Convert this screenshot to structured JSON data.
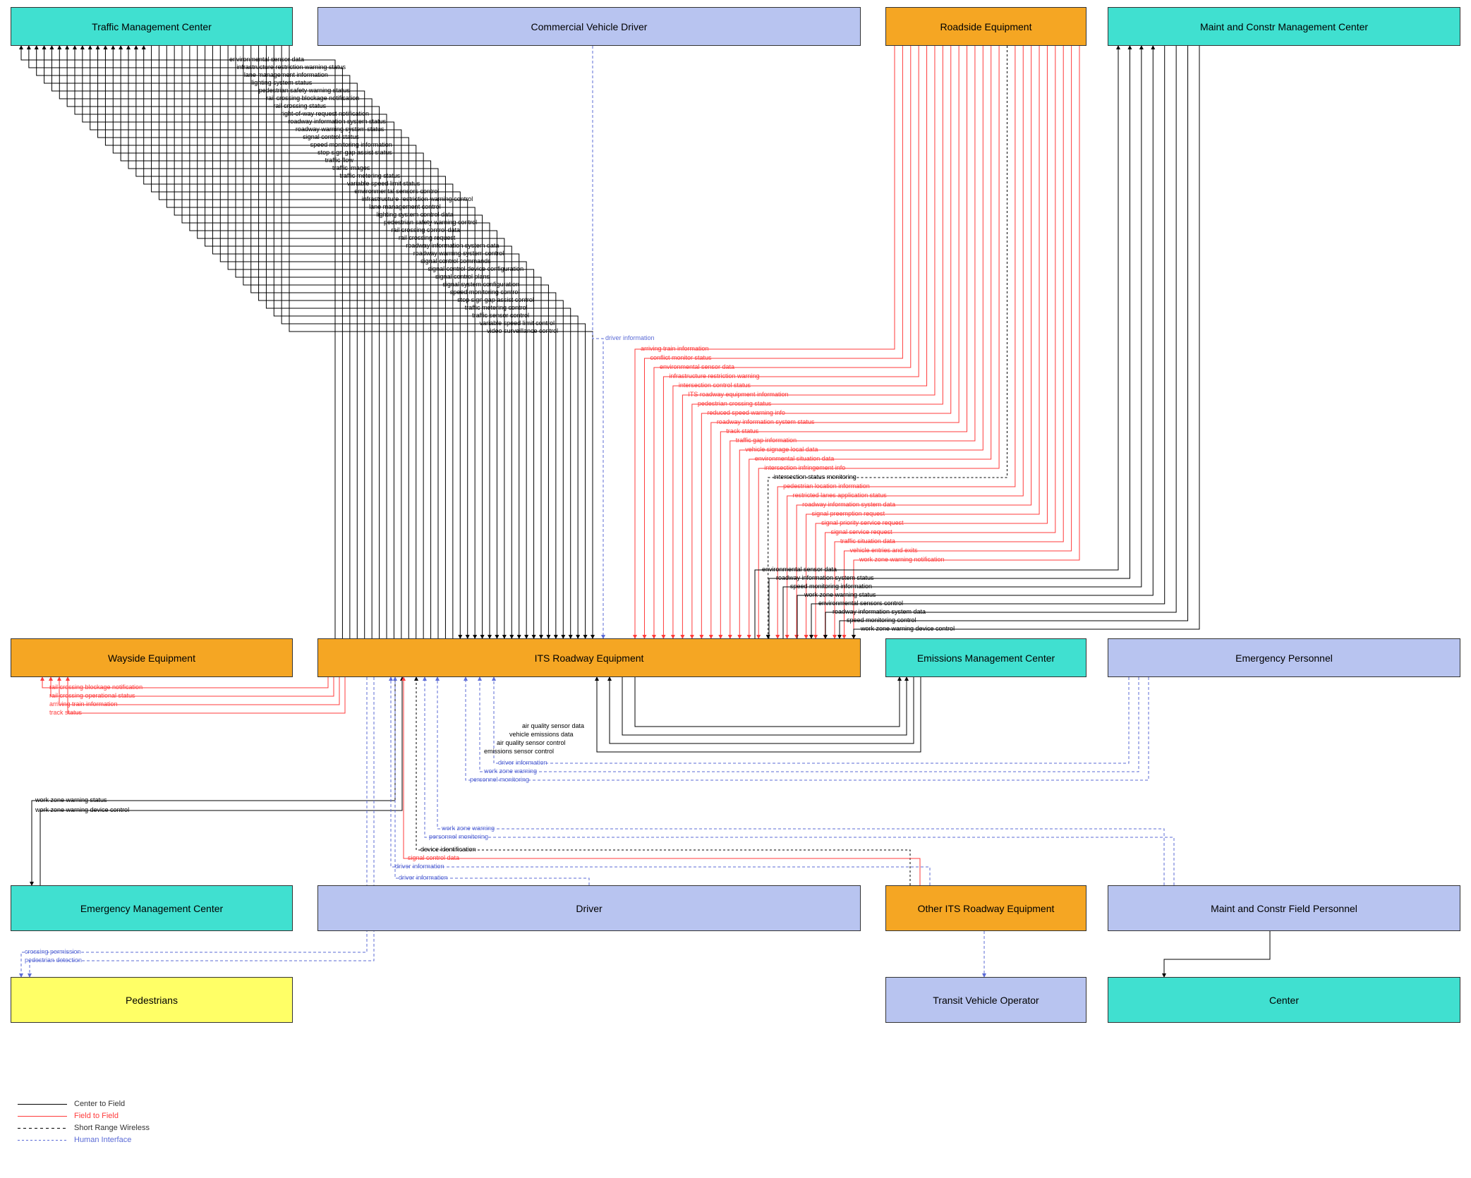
{
  "nodes": {
    "tmc": "Traffic Management Center",
    "cvd": "Commercial Vehicle Driver",
    "re": "Roadside Equipment",
    "mcmc": "Maint and Constr Management Center",
    "we": "Wayside Equipment",
    "its": "ITS Roadway Equipment",
    "emc": "Emissions Management Center",
    "ep": "Emergency Personnel",
    "emgmt": "Emergency Management Center",
    "drv": "Driver",
    "oire": "Other ITS Roadway Equipment",
    "mcfp": "Maint and Constr Field Personnel",
    "ped": "Pedestrians",
    "tvo": "Transit Vehicle Operator",
    "ctr": "Center"
  },
  "legend": {
    "c2f": "Center to Field",
    "f2f": "Field to Field",
    "srw": "Short Range Wireless",
    "hi": "Human Interface"
  },
  "tmc_outgoing": [
    "environmental sensor data",
    "infrastructure restriction warning status",
    "lane management information",
    "lighting system status",
    "pedestrian safety warning status",
    "rail crossing blockage notification",
    "rail crossing status",
    "right-of-way request notification",
    "roadway information system status",
    "roadway warning system status",
    "signal control status",
    "speed monitoring information",
    "stop sign gap assist status",
    "traffic flow",
    "traffic images",
    "traffic metering status",
    "variable speed limit status"
  ],
  "tmc_incoming": [
    "environmental sensors control",
    "infrastructure restriction warning control",
    "lane management control",
    "lighting system control data",
    "pedestrian safety warning control",
    "rail crossing control data",
    "rail crossing request",
    "roadway information system data",
    "roadway warning system control",
    "signal control commands",
    "signal control device configuration",
    "signal control plans",
    "signal system configuration",
    "speed monitoring control",
    "stop sign gap assist control",
    "traffic metering control",
    "traffic sensor control",
    "variable speed limit control",
    "video surveillance control"
  ],
  "re_red": [
    "arriving train information",
    "conflict monitor status",
    "environmental sensor data",
    "infrastructure restriction warning",
    "intersection control status",
    "ITS roadway equipment information",
    "pedestrian crossing status",
    "reduced speed warning info",
    "roadway information system status",
    "track status",
    "traffic gap information",
    "vehicle signage local data",
    "environmental situation data",
    "intersection infringement info"
  ],
  "re_black": [
    "intersection status monitoring"
  ],
  "re_red_down": [
    "pedestrian location information",
    "restricted lanes application status",
    "roadway information system data",
    "signal preemption request",
    "signal priority service request",
    "signal service request",
    "traffic situation data",
    "vehicle entries and exits",
    "work zone warning notification"
  ],
  "mcmc_list": [
    "environmental sensor data",
    "roadway information system status",
    "speed monitoring information",
    "work zone warning status",
    "environmental sensors control",
    "roadway information system data",
    "speed monitoring control",
    "work zone warning device control"
  ],
  "we_list": [
    "rail crossing blockage notification",
    "rail crossing operational status",
    "arriving train information",
    "track status"
  ],
  "emgmt_list": [
    "work zone warning status",
    "work zone warning device control"
  ],
  "ped_list": [
    "crossing permission",
    "pedestrian detection"
  ],
  "emc_list": [
    "air quality sensor data",
    "vehicle emissions data",
    "air quality sensor control",
    "emissions sensor control"
  ],
  "drv_below": [
    "driver information"
  ],
  "ep_list": [
    "driver information",
    "work zone warning",
    "personnel monitoring"
  ],
  "mcfp_list": [
    "work zone warning",
    "personnel monitoring"
  ],
  "oire_list": [
    "device identification",
    "signal control data",
    "driver information"
  ],
  "cvd_list": [
    "driver information"
  ]
}
